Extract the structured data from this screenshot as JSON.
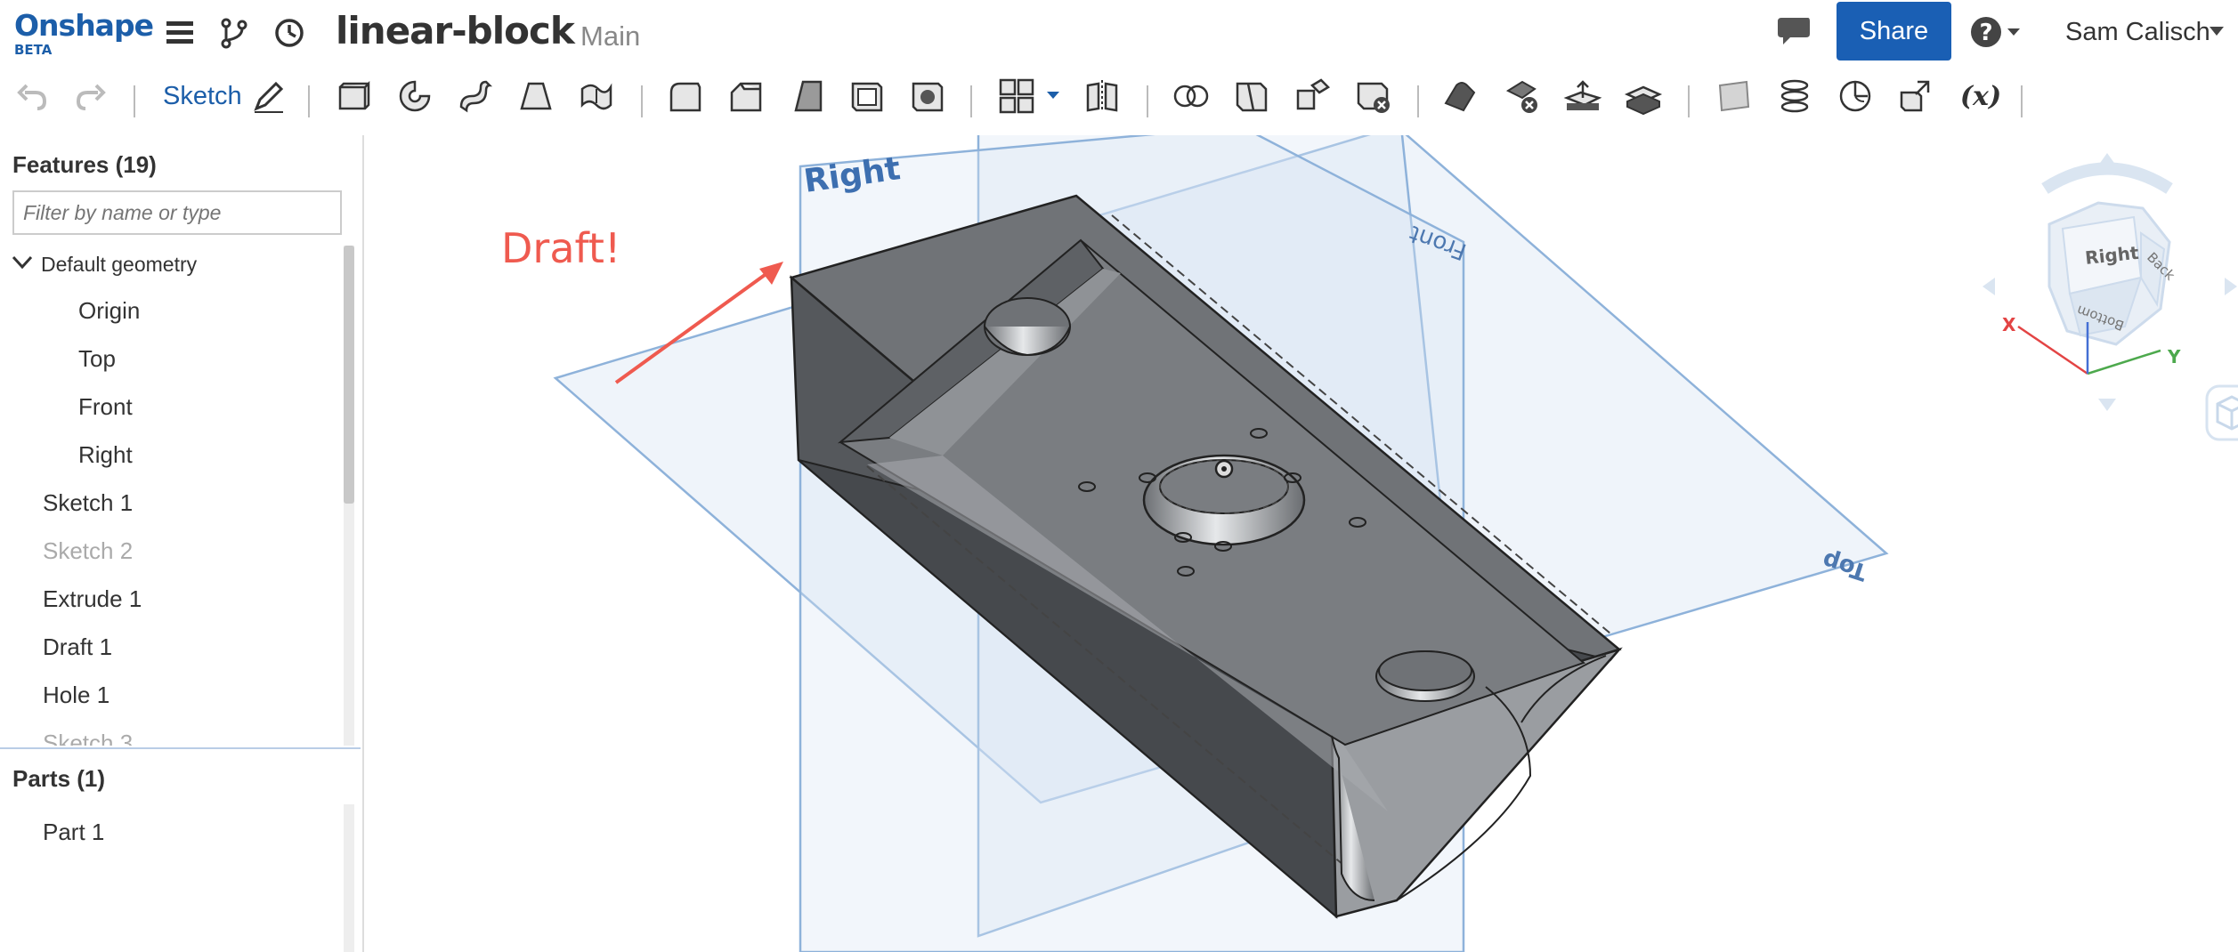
{
  "app": {
    "brand": "Onshape",
    "badge": "BETA"
  },
  "document": {
    "title": "linear-block",
    "branch": "Main"
  },
  "header": {
    "share_label": "Share",
    "user_name": "Sam Calisch"
  },
  "toolbar": {
    "sketch_label": "Sketch"
  },
  "features": {
    "heading": "Features (19)",
    "filter_placeholder": "Filter by name or type",
    "group": "Default geometry",
    "planes": [
      "Origin",
      "Top",
      "Front",
      "Right"
    ],
    "items": [
      {
        "label": "Sketch 1",
        "suppressed": false
      },
      {
        "label": "Sketch 2",
        "suppressed": true
      },
      {
        "label": "Extrude 1",
        "suppressed": false
      },
      {
        "label": "Draft 1",
        "suppressed": false
      },
      {
        "label": "Hole 1",
        "suppressed": false
      },
      {
        "label": "Sketch 3",
        "suppressed": true
      }
    ]
  },
  "parts": {
    "heading": "Parts (1)",
    "items": [
      "Part 1"
    ]
  },
  "annotation": {
    "text": "Draft!"
  },
  "planes": {
    "right": "Right",
    "front": "Front",
    "top": "Top"
  },
  "viewcube": {
    "face_right": "Right",
    "face_back": "Back",
    "face_bottom": "Bottom",
    "axis_x": "X",
    "axis_y": "Y"
  },
  "colors": {
    "brand": "#1c5ea9",
    "annotation": "#ef5a4f",
    "plane": "#b9cde6",
    "part": "#6b6e72"
  }
}
